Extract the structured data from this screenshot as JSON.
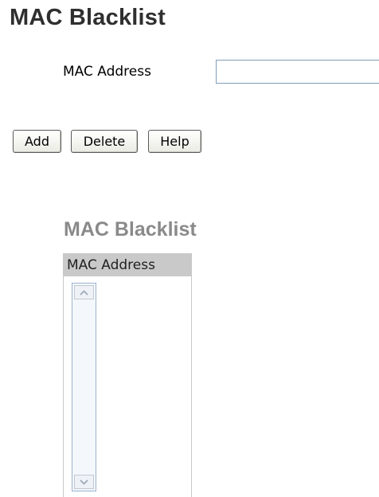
{
  "page": {
    "title": "MAC Blacklist"
  },
  "form": {
    "mac_label": "MAC Address",
    "mac_value": "",
    "mac_placeholder": ""
  },
  "buttons": {
    "add": "Add",
    "delete": "Delete",
    "help": "Help"
  },
  "list": {
    "title": "MAC Blacklist",
    "column_header": "MAC Address",
    "items": []
  },
  "icons": {
    "scroll_up": "chevron-up-icon",
    "scroll_down": "chevron-down-icon"
  },
  "colors": {
    "title": "#2f2f2f",
    "list_title": "#8a8a8a",
    "header_bg": "#c9c9c9",
    "input_border": "#7f9db9"
  }
}
